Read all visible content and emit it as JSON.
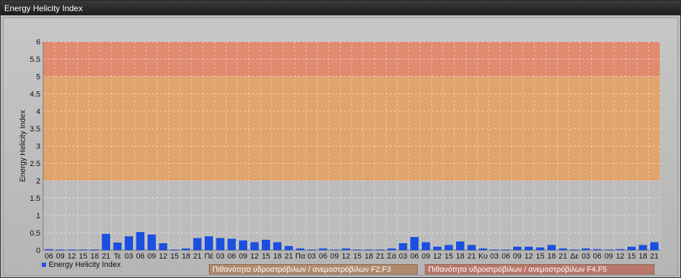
{
  "window": {
    "title": "Energy Helicity Index"
  },
  "legend": {
    "series_label": "Energy Helicity Index",
    "band1_label": "Πιθανότητα υδροστρόβιλων / ανεμοστρόβιλων F2,F3",
    "band2_label": "Πιθανότητα υδροστρόβιλων / ανεμοστρόβιλων F4,F5",
    "band1_color": "#b08a6c",
    "band2_color": "#b9766a"
  },
  "chart_data": {
    "type": "bar",
    "title": "",
    "ylabel": "Energy Helicity Index",
    "xlabel": "",
    "ylim": [
      0,
      6
    ],
    "yticks": [
      0,
      0.5,
      1,
      1.5,
      2,
      2.5,
      3,
      3.5,
      4,
      4.5,
      5,
      5.5,
      6
    ],
    "grid": true,
    "legend_position": "bottom-left",
    "bar_color": "#1a4fe0",
    "bands": [
      {
        "from": 0,
        "to": 2,
        "color": "#bcbcbc"
      },
      {
        "from": 2,
        "to": 5,
        "color": "#e0a46c"
      },
      {
        "from": 5,
        "to": 6,
        "color": "#e08a70"
      }
    ],
    "categories": [
      "06",
      "09",
      "12",
      "15",
      "18",
      "21",
      "Τε",
      "03",
      "06",
      "09",
      "12",
      "15",
      "18",
      "21",
      "Πέ",
      "03",
      "06",
      "09",
      "12",
      "15",
      "18",
      "21",
      "Πα",
      "03",
      "06",
      "09",
      "12",
      "15",
      "18",
      "21",
      "Σά",
      "03",
      "06",
      "09",
      "12",
      "15",
      "18",
      "21",
      "Κυ",
      "03",
      "06",
      "09",
      "12",
      "15",
      "18",
      "21",
      "Δε",
      "03",
      "06",
      "09",
      "12",
      "15",
      "18",
      "21"
    ],
    "series": [
      {
        "name": "Energy Helicity Index",
        "values": [
          0.03,
          0.02,
          0.02,
          0.02,
          0.02,
          0.47,
          0.22,
          0.4,
          0.52,
          0.45,
          0.2,
          0.01,
          0.05,
          0.35,
          0.4,
          0.35,
          0.33,
          0.28,
          0.23,
          0.3,
          0.23,
          0.12,
          0.05,
          0.02,
          0.05,
          0.02,
          0.05,
          0.02,
          0.01,
          0.01,
          0.05,
          0.2,
          0.38,
          0.23,
          0.1,
          0.15,
          0.25,
          0.15,
          0.05,
          0.02,
          0.02,
          0.1,
          0.1,
          0.08,
          0.15,
          0.05,
          0.02,
          0.05,
          0.03,
          0.02,
          0.03,
          0.1,
          0.15,
          0.23
        ]
      }
    ]
  }
}
